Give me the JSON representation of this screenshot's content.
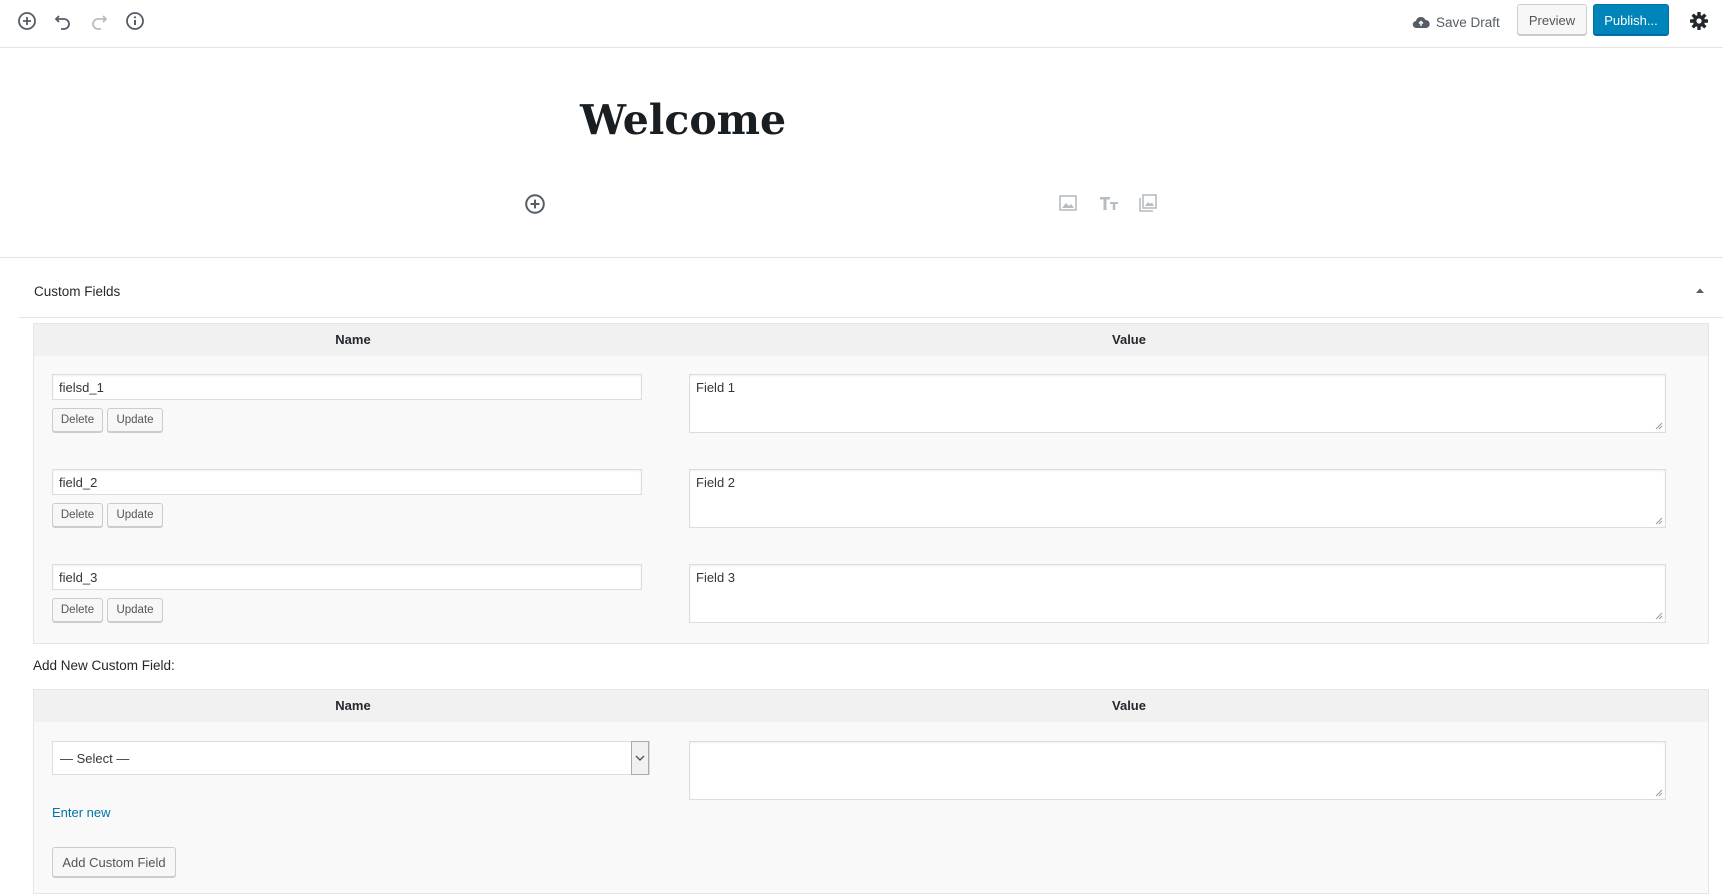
{
  "toolbar": {
    "inserter_icon": "plus-circle-icon",
    "undo_icon": "undo-icon",
    "redo_icon": "redo-icon",
    "info_icon": "info-icon",
    "save_draft_label": "Save Draft",
    "preview_label": "Preview",
    "publish_label": "Publish...",
    "settings_icon": "gear-icon",
    "publish_color": "#0085ba"
  },
  "editor": {
    "title": "Welcome",
    "block_icons": [
      "image-icon",
      "heading-icon",
      "gallery-icon"
    ]
  },
  "custom_fields": {
    "panel_title": "Custom Fields",
    "name_header": "Name",
    "value_header": "Value",
    "delete_label": "Delete",
    "update_label": "Update",
    "rows": [
      {
        "name": "fielsd_1",
        "value": "Field 1"
      },
      {
        "name": "field_2",
        "value": "Field 2"
      },
      {
        "name": "field_3",
        "value": "Field 3"
      }
    ]
  },
  "add_new": {
    "label": "Add New Custom Field:",
    "name_header": "Name",
    "value_header": "Value",
    "select_value": "— Select —",
    "enter_new_label": "Enter new",
    "value": "",
    "add_button_label": "Add Custom Field"
  }
}
